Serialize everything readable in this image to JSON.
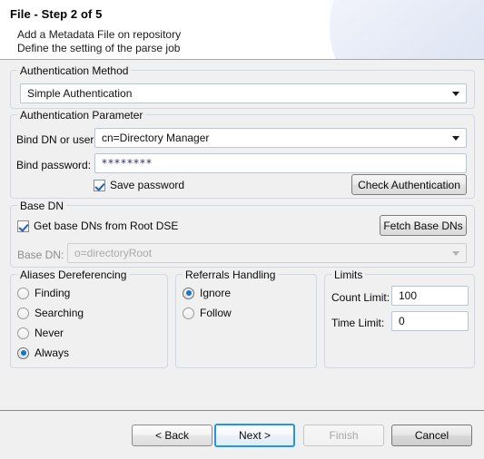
{
  "header": {
    "title": "File - Step 2 of 5",
    "subtitle1": "Add a Metadata File on repository",
    "subtitle2": "Define the setting of the parse job"
  },
  "auth_method": {
    "group_title": "Authentication Method",
    "combo_value": "Simple Authentication"
  },
  "auth_parameter": {
    "group_title": "Authentication Parameter",
    "bind_dn_label": "Bind DN or user:",
    "bind_dn_value": "cn=Directory Manager",
    "bind_password_label": "Bind password:",
    "bind_password_value": "********",
    "save_password_label": "Save password",
    "check_auth_label": "Check Authentication"
  },
  "base_dn": {
    "group_title": "Base DN",
    "get_base_dns_label": "Get base DNs from Root DSE",
    "fetch_label": "Fetch Base DNs",
    "base_dn_label": "Base DN:",
    "base_dn_value": "o=directoryRoot"
  },
  "aliases": {
    "group_title": "Aliases Dereferencing",
    "options": [
      {
        "label": "Finding",
        "selected": false
      },
      {
        "label": "Searching",
        "selected": false
      },
      {
        "label": "Never",
        "selected": false
      },
      {
        "label": "Always",
        "selected": true
      }
    ]
  },
  "referrals": {
    "group_title": "Referrals Handling",
    "options": [
      {
        "label": "Ignore",
        "selected": true
      },
      {
        "label": "Follow",
        "selected": false
      }
    ]
  },
  "limits": {
    "group_title": "Limits",
    "count_limit_label": "Count Limit:",
    "count_limit_value": "100",
    "time_limit_label": "Time Limit:",
    "time_limit_value": "0"
  },
  "footer": {
    "back_label": "< Back",
    "next_label": "Next >",
    "finish_label": "Finish",
    "cancel_label": "Cancel"
  },
  "colors": {
    "accent": "#2196e3",
    "group_border": "#cfd8e4",
    "dialog_bg": "#f0f0f0",
    "radio_dot": "#1277c8",
    "check_mark": "#1c5fbe"
  },
  "icons": {
    "combo_arrow": "chevron-down-icon",
    "check_mark": "check-icon"
  }
}
